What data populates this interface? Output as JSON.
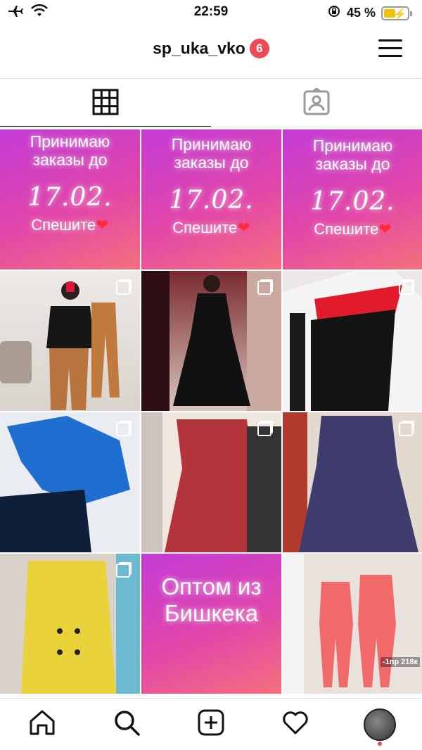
{
  "status_bar": {
    "time": "22:59",
    "battery_percent": "45 %",
    "battery_level": 0.45,
    "icons": [
      "airplane-icon",
      "wifi-icon",
      "orientation-lock-icon",
      "battery-icon"
    ]
  },
  "header": {
    "username": "sp_uka_vko",
    "notification_count": "6"
  },
  "tabs": [
    {
      "icon": "grid-icon",
      "active": true
    },
    {
      "icon": "tagged-icon",
      "active": false
    }
  ],
  "posts": {
    "promo": {
      "line1": "Принимаю",
      "line2": "заказы до",
      "date": "17.02.",
      "line3": "Спешите",
      "heart": "❤"
    },
    "wholesale": {
      "line1": "Оптом из",
      "line2": "Бишкека"
    },
    "price_caption": "-1пр 218к"
  },
  "bottom_nav": [
    "home-icon",
    "search-icon",
    "new-post-icon",
    "activity-heart-icon",
    "profile-avatar"
  ],
  "colors": {
    "badge": "#ed4956",
    "promo_gradient_start": "#c23bd6",
    "promo_gradient_end": "#f5707d"
  }
}
